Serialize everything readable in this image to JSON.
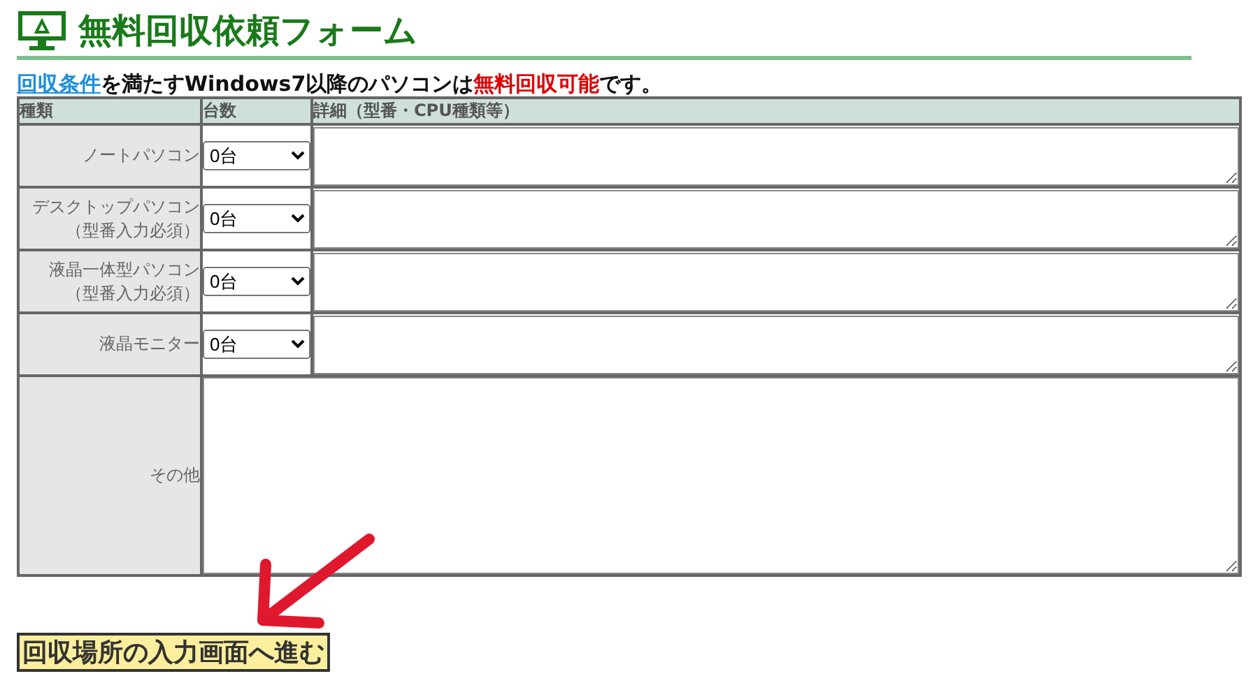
{
  "title": "無料回収依頼フォーム",
  "intro": [
    {
      "kind": "link",
      "text": "回収条件"
    },
    {
      "kind": "plain",
      "text": "を満たすWindows7以降のパソコンは"
    },
    {
      "kind": "emphasis",
      "text": "無料回収可能"
    },
    {
      "kind": "plain",
      "text": "です。"
    }
  ],
  "table": {
    "columns": [
      "種類",
      "台数",
      "詳細（型番・CPU種類等）"
    ],
    "rows": [
      {
        "kind": "count",
        "label": "ノートパソコン",
        "select": "0台"
      },
      {
        "kind": "count",
        "label": "デスクトップパソコン",
        "note": "（型番入力必須）",
        "select": "0台"
      },
      {
        "kind": "count",
        "label": "液晶一体型パソコン",
        "note": "（型番入力必須）",
        "select": "0台"
      },
      {
        "kind": "count",
        "label": "液晶モニター",
        "select": "0台"
      },
      {
        "kind": "other",
        "label": "その他"
      }
    ]
  },
  "next_button": "回収場所の入力画面へ進む"
}
